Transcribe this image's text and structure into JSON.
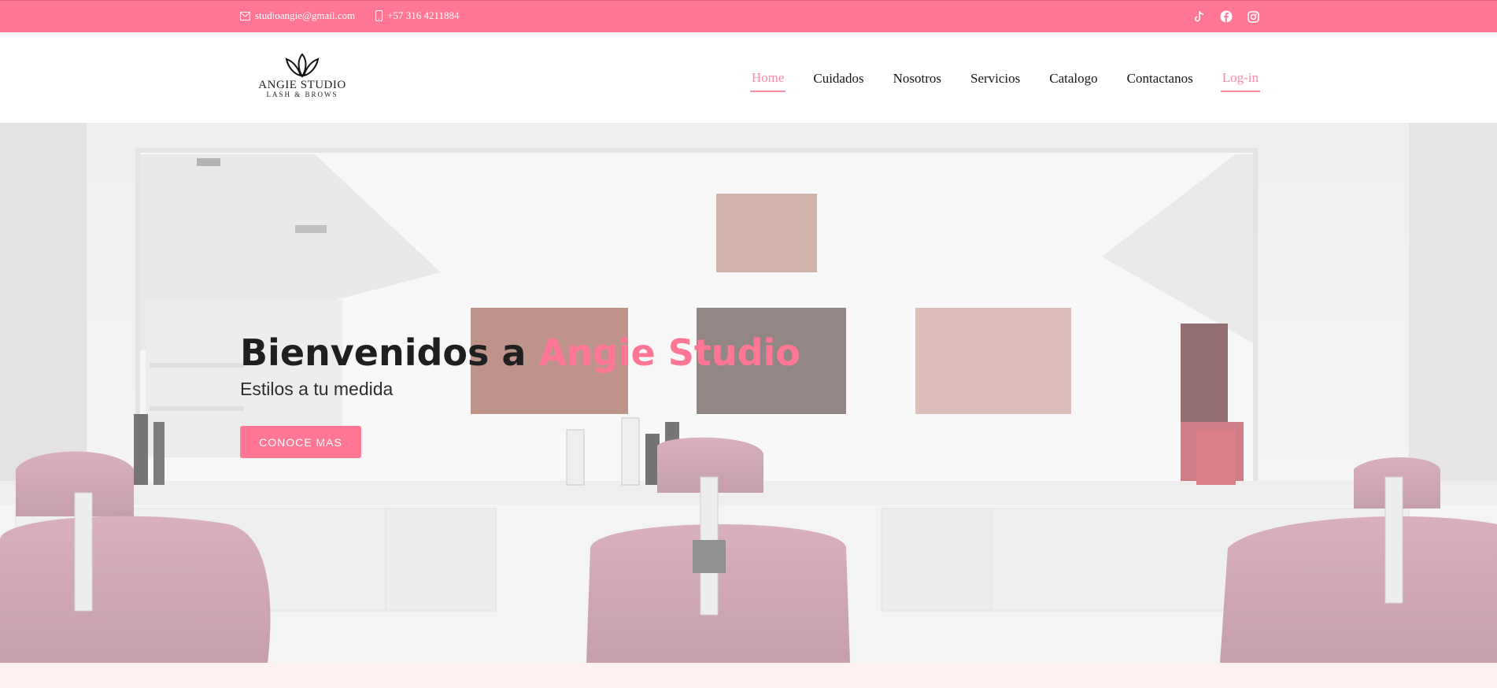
{
  "topbar": {
    "email": "studioangie@gmail.com",
    "phone": "+57 316 4211884",
    "social_icons": [
      "tiktok-icon",
      "facebook-icon",
      "instagram-icon"
    ],
    "bg_color": "#ff7794"
  },
  "header": {
    "logo_brand": "ANGIE STUDIO",
    "logo_tagline": "LASH & BROWS",
    "nav": [
      "Home",
      "Cuidados",
      "Nosotros",
      "Servicios",
      "Catalogo",
      "Contactanos",
      "Log-in"
    ],
    "active_item": "Home"
  },
  "hero": {
    "title_prefix": "Bienvenidos a ",
    "title_accent": "Angie Studio",
    "subtitle": "Estilos a tu medida",
    "button_label": "CONOCE MAS",
    "accent_color": "#ff7794"
  }
}
